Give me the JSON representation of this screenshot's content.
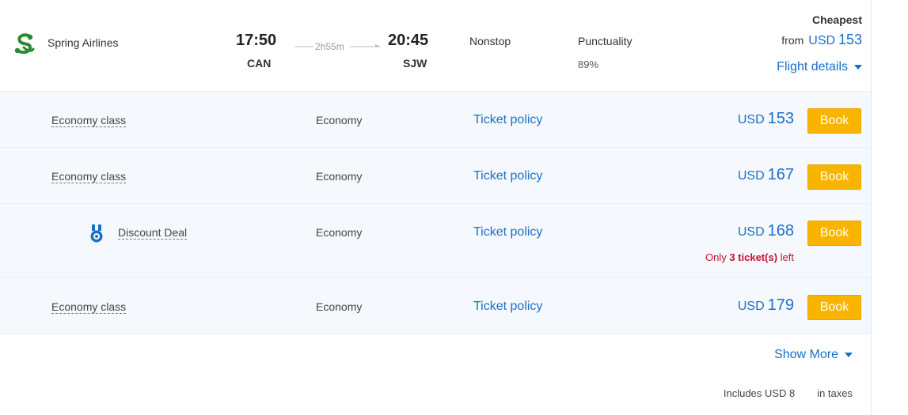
{
  "flight": {
    "airline": "Spring Airlines",
    "departure_time": "17:50",
    "departure_code": "CAN",
    "duration": "2h55m",
    "arrival_time": "20:45",
    "arrival_code": "SJW",
    "stops": "Nonstop",
    "punctuality_label": "Punctuality",
    "punctuality_value": "89%",
    "cheapest_label": "Cheapest",
    "from_label": "from",
    "from_currency": "USD",
    "from_amount": "153",
    "details_label": "Flight details"
  },
  "fares": [
    {
      "name": "Economy class",
      "cabin": "Economy",
      "policy": "Ticket policy",
      "currency": "USD",
      "amount": "153",
      "book": "Book"
    },
    {
      "name": "Economy class",
      "cabin": "Economy",
      "policy": "Ticket policy",
      "currency": "USD",
      "amount": "167",
      "book": "Book"
    },
    {
      "name": "Discount Deal",
      "cabin": "Economy",
      "policy": "Ticket policy",
      "currency": "USD",
      "amount": "168",
      "book": "Book",
      "note_prefix": "Only",
      "note_count": "3 ticket(s)",
      "note_suffix": "left"
    },
    {
      "name": "Economy class",
      "cabin": "Economy",
      "policy": "Ticket policy",
      "currency": "USD",
      "amount": "179",
      "book": "Book"
    }
  ],
  "footer": {
    "show_more": "Show More",
    "taxes_prefix": "Includes USD 8",
    "taxes_suffix": "in taxes"
  },
  "icons": {
    "airline_logo": "spring-airlines-logo-icon",
    "deal_badge": "medal-icon",
    "dropdown": "chevron-down-icon"
  },
  "colors": {
    "link_blue": "#1a6fc9",
    "book_orange": "#f9b400",
    "logo_green": "#2a8a2e",
    "warning_red": "#c8102e",
    "row_bg": "#f5f9fd"
  }
}
